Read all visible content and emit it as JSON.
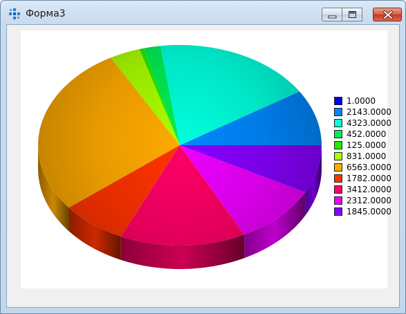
{
  "window": {
    "title": "Форма3",
    "buttons": [
      "minimize",
      "maximize",
      "close"
    ],
    "icon": "app-grid-icon"
  },
  "chart_data": {
    "type": "pie",
    "style": "3d",
    "legend_position": "right",
    "colors": [
      "#0000ff",
      "#0088ff",
      "#00ffdd",
      "#00ee55",
      "#22ee00",
      "#aaff00",
      "#ffaa00",
      "#ff3300",
      "#ff0066",
      "#ee00ff",
      "#8800ff"
    ],
    "values": [
      1.0,
      2143.0,
      4323.0,
      452.0,
      125.0,
      831.0,
      6563.0,
      1782.0,
      3412.0,
      2312.0,
      1845.0
    ],
    "legend": [
      "1.0000",
      "2143.0000",
      "4323.0000",
      "452.0000",
      "125.0000",
      "831.0000",
      "6563.0000",
      "1782.0000",
      "3412.0000",
      "2312.0000",
      "1845.0000"
    ]
  }
}
